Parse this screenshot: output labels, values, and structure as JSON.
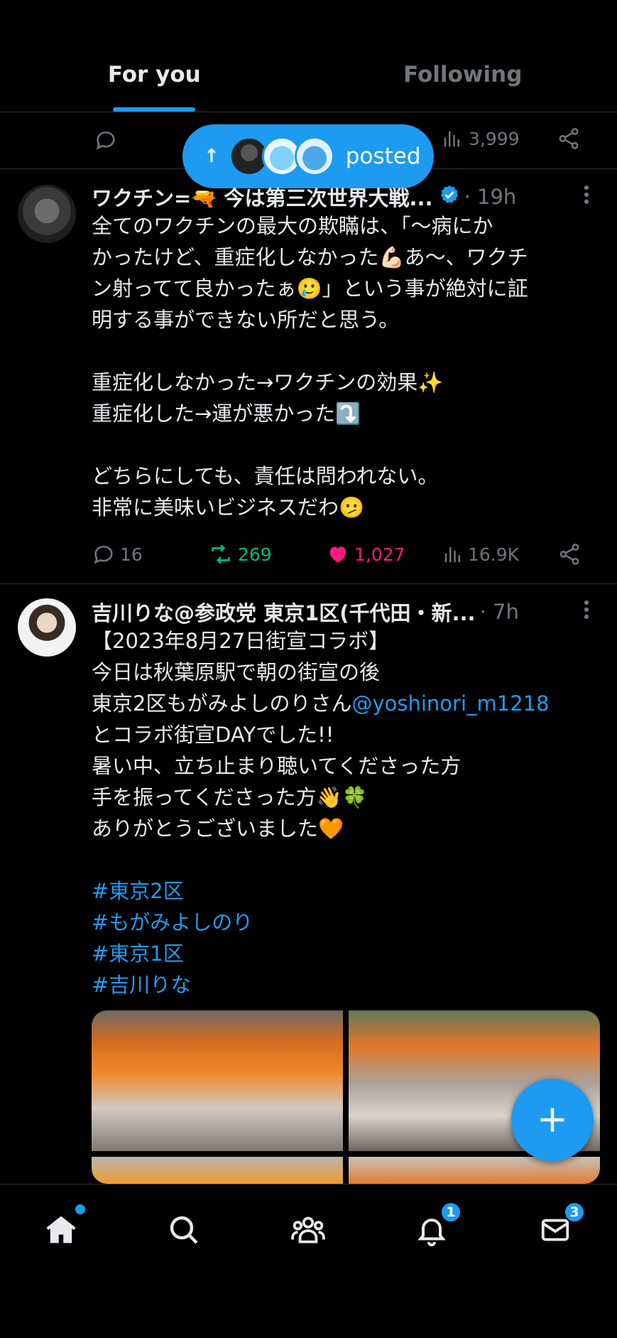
{
  "tabs": [
    {
      "label": "For you",
      "active": true
    },
    {
      "label": "Following",
      "active": false
    }
  ],
  "prev_tweet": {
    "views": "3,999"
  },
  "posted_pill": {
    "label": "posted"
  },
  "tweets": [
    {
      "name": "ワクチン=🔫 今は第三次世界大戦...",
      "verified": true,
      "time": "· 19h",
      "lines": [
        "全てのワクチンの最大の欺瞞は、「〜病にか",
        "かったけど、重症化しなかった💪🏻あ〜、ワクチ",
        "ン射ってて良かったぁ🥲」という事が絶対に証",
        "明する事ができない所だと思う。",
        "",
        "重症化しなかった→ワクチンの効果✨",
        "重症化した→運が悪かった⤵️",
        "",
        "どちらにしても、責任は問われない。",
        "非常に美味いビジネスだわ🫤"
      ],
      "replies": "16",
      "retweets": "269",
      "likes": "1,027",
      "views": "16.9K"
    },
    {
      "name": "吉川りな@参政党 東京1区(千代田・新...",
      "verified": false,
      "time": "· 7h",
      "lines": [
        "【2023年8月27日街宣コラボ】",
        "今日は秋葉原駅で朝の街宣の後",
        "東京2区もがみよしのりさん",
        "とコラボ街宣DAYでした!!",
        "暑い中、立ち止まり聴いてくださった方",
        "手を振ってくださった方👋🍀",
        "ありがとうございました🧡",
        "",
        "#東京2区",
        "#もがみよしのり",
        "#東京1区",
        "#吉川りな"
      ],
      "mention": "@yoshinori_m1218"
    }
  ],
  "bottom_nav": {
    "notifications_badge": "1",
    "messages_badge": "3"
  },
  "colors": {
    "accent": "#1d9bf0",
    "retweet": "#00ba7c",
    "like": "#f91880",
    "muted": "#71767b"
  }
}
